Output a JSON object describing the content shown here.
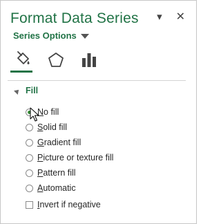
{
  "pane": {
    "title": "Format Data Series",
    "dropdown_label": "Series Options",
    "close_glyph": "✕",
    "menu_glyph": "▾"
  },
  "tabs": [
    {
      "name": "fill-line-tab",
      "icon": "paint-bucket-icon",
      "active": true
    },
    {
      "name": "effects-tab",
      "icon": "pentagon-icon",
      "active": false
    },
    {
      "name": "series-options-tab",
      "icon": "bar-chart-icon",
      "active": false
    }
  ],
  "fill_section": {
    "header": "Fill",
    "options": [
      {
        "first": "N",
        "rest": "o fill",
        "checked": true
      },
      {
        "first": "S",
        "rest": "olid fill",
        "checked": false
      },
      {
        "first": "G",
        "rest": "radient fill",
        "checked": false
      },
      {
        "first": "P",
        "rest": "icture or texture fill",
        "checked": false
      },
      {
        "first": "P",
        "rest": "attern fill",
        "checked": false
      },
      {
        "first": "A",
        "rest": "utomatic",
        "checked": false
      }
    ],
    "invert": {
      "first": "I",
      "rest": "nvert if negative",
      "checked": false
    }
  },
  "colors": {
    "accent": "#217346",
    "radio_dot": "#3a8e3a",
    "border": "#c6c6c6"
  }
}
